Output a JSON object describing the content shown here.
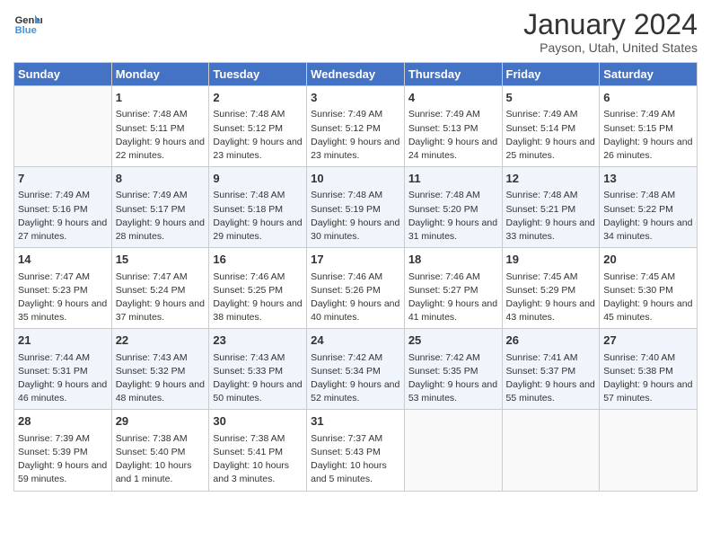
{
  "header": {
    "logo_line1": "General",
    "logo_line2": "Blue",
    "month": "January 2024",
    "location": "Payson, Utah, United States"
  },
  "weekdays": [
    "Sunday",
    "Monday",
    "Tuesday",
    "Wednesday",
    "Thursday",
    "Friday",
    "Saturday"
  ],
  "weeks": [
    [
      {
        "day": "",
        "content": ""
      },
      {
        "day": "1",
        "content": "Sunrise: 7:48 AM\nSunset: 5:11 PM\nDaylight: 9 hours and 22 minutes."
      },
      {
        "day": "2",
        "content": "Sunrise: 7:48 AM\nSunset: 5:12 PM\nDaylight: 9 hours and 23 minutes."
      },
      {
        "day": "3",
        "content": "Sunrise: 7:49 AM\nSunset: 5:12 PM\nDaylight: 9 hours and 23 minutes."
      },
      {
        "day": "4",
        "content": "Sunrise: 7:49 AM\nSunset: 5:13 PM\nDaylight: 9 hours and 24 minutes."
      },
      {
        "day": "5",
        "content": "Sunrise: 7:49 AM\nSunset: 5:14 PM\nDaylight: 9 hours and 25 minutes."
      },
      {
        "day": "6",
        "content": "Sunrise: 7:49 AM\nSunset: 5:15 PM\nDaylight: 9 hours and 26 minutes."
      }
    ],
    [
      {
        "day": "7",
        "content": "Sunrise: 7:49 AM\nSunset: 5:16 PM\nDaylight: 9 hours and 27 minutes."
      },
      {
        "day": "8",
        "content": "Sunrise: 7:49 AM\nSunset: 5:17 PM\nDaylight: 9 hours and 28 minutes."
      },
      {
        "day": "9",
        "content": "Sunrise: 7:48 AM\nSunset: 5:18 PM\nDaylight: 9 hours and 29 minutes."
      },
      {
        "day": "10",
        "content": "Sunrise: 7:48 AM\nSunset: 5:19 PM\nDaylight: 9 hours and 30 minutes."
      },
      {
        "day": "11",
        "content": "Sunrise: 7:48 AM\nSunset: 5:20 PM\nDaylight: 9 hours and 31 minutes."
      },
      {
        "day": "12",
        "content": "Sunrise: 7:48 AM\nSunset: 5:21 PM\nDaylight: 9 hours and 33 minutes."
      },
      {
        "day": "13",
        "content": "Sunrise: 7:48 AM\nSunset: 5:22 PM\nDaylight: 9 hours and 34 minutes."
      }
    ],
    [
      {
        "day": "14",
        "content": "Sunrise: 7:47 AM\nSunset: 5:23 PM\nDaylight: 9 hours and 35 minutes."
      },
      {
        "day": "15",
        "content": "Sunrise: 7:47 AM\nSunset: 5:24 PM\nDaylight: 9 hours and 37 minutes."
      },
      {
        "day": "16",
        "content": "Sunrise: 7:46 AM\nSunset: 5:25 PM\nDaylight: 9 hours and 38 minutes."
      },
      {
        "day": "17",
        "content": "Sunrise: 7:46 AM\nSunset: 5:26 PM\nDaylight: 9 hours and 40 minutes."
      },
      {
        "day": "18",
        "content": "Sunrise: 7:46 AM\nSunset: 5:27 PM\nDaylight: 9 hours and 41 minutes."
      },
      {
        "day": "19",
        "content": "Sunrise: 7:45 AM\nSunset: 5:29 PM\nDaylight: 9 hours and 43 minutes."
      },
      {
        "day": "20",
        "content": "Sunrise: 7:45 AM\nSunset: 5:30 PM\nDaylight: 9 hours and 45 minutes."
      }
    ],
    [
      {
        "day": "21",
        "content": "Sunrise: 7:44 AM\nSunset: 5:31 PM\nDaylight: 9 hours and 46 minutes."
      },
      {
        "day": "22",
        "content": "Sunrise: 7:43 AM\nSunset: 5:32 PM\nDaylight: 9 hours and 48 minutes."
      },
      {
        "day": "23",
        "content": "Sunrise: 7:43 AM\nSunset: 5:33 PM\nDaylight: 9 hours and 50 minutes."
      },
      {
        "day": "24",
        "content": "Sunrise: 7:42 AM\nSunset: 5:34 PM\nDaylight: 9 hours and 52 minutes."
      },
      {
        "day": "25",
        "content": "Sunrise: 7:42 AM\nSunset: 5:35 PM\nDaylight: 9 hours and 53 minutes."
      },
      {
        "day": "26",
        "content": "Sunrise: 7:41 AM\nSunset: 5:37 PM\nDaylight: 9 hours and 55 minutes."
      },
      {
        "day": "27",
        "content": "Sunrise: 7:40 AM\nSunset: 5:38 PM\nDaylight: 9 hours and 57 minutes."
      }
    ],
    [
      {
        "day": "28",
        "content": "Sunrise: 7:39 AM\nSunset: 5:39 PM\nDaylight: 9 hours and 59 minutes."
      },
      {
        "day": "29",
        "content": "Sunrise: 7:38 AM\nSunset: 5:40 PM\nDaylight: 10 hours and 1 minute."
      },
      {
        "day": "30",
        "content": "Sunrise: 7:38 AM\nSunset: 5:41 PM\nDaylight: 10 hours and 3 minutes."
      },
      {
        "day": "31",
        "content": "Sunrise: 7:37 AM\nSunset: 5:43 PM\nDaylight: 10 hours and 5 minutes."
      },
      {
        "day": "",
        "content": ""
      },
      {
        "day": "",
        "content": ""
      },
      {
        "day": "",
        "content": ""
      }
    ]
  ]
}
